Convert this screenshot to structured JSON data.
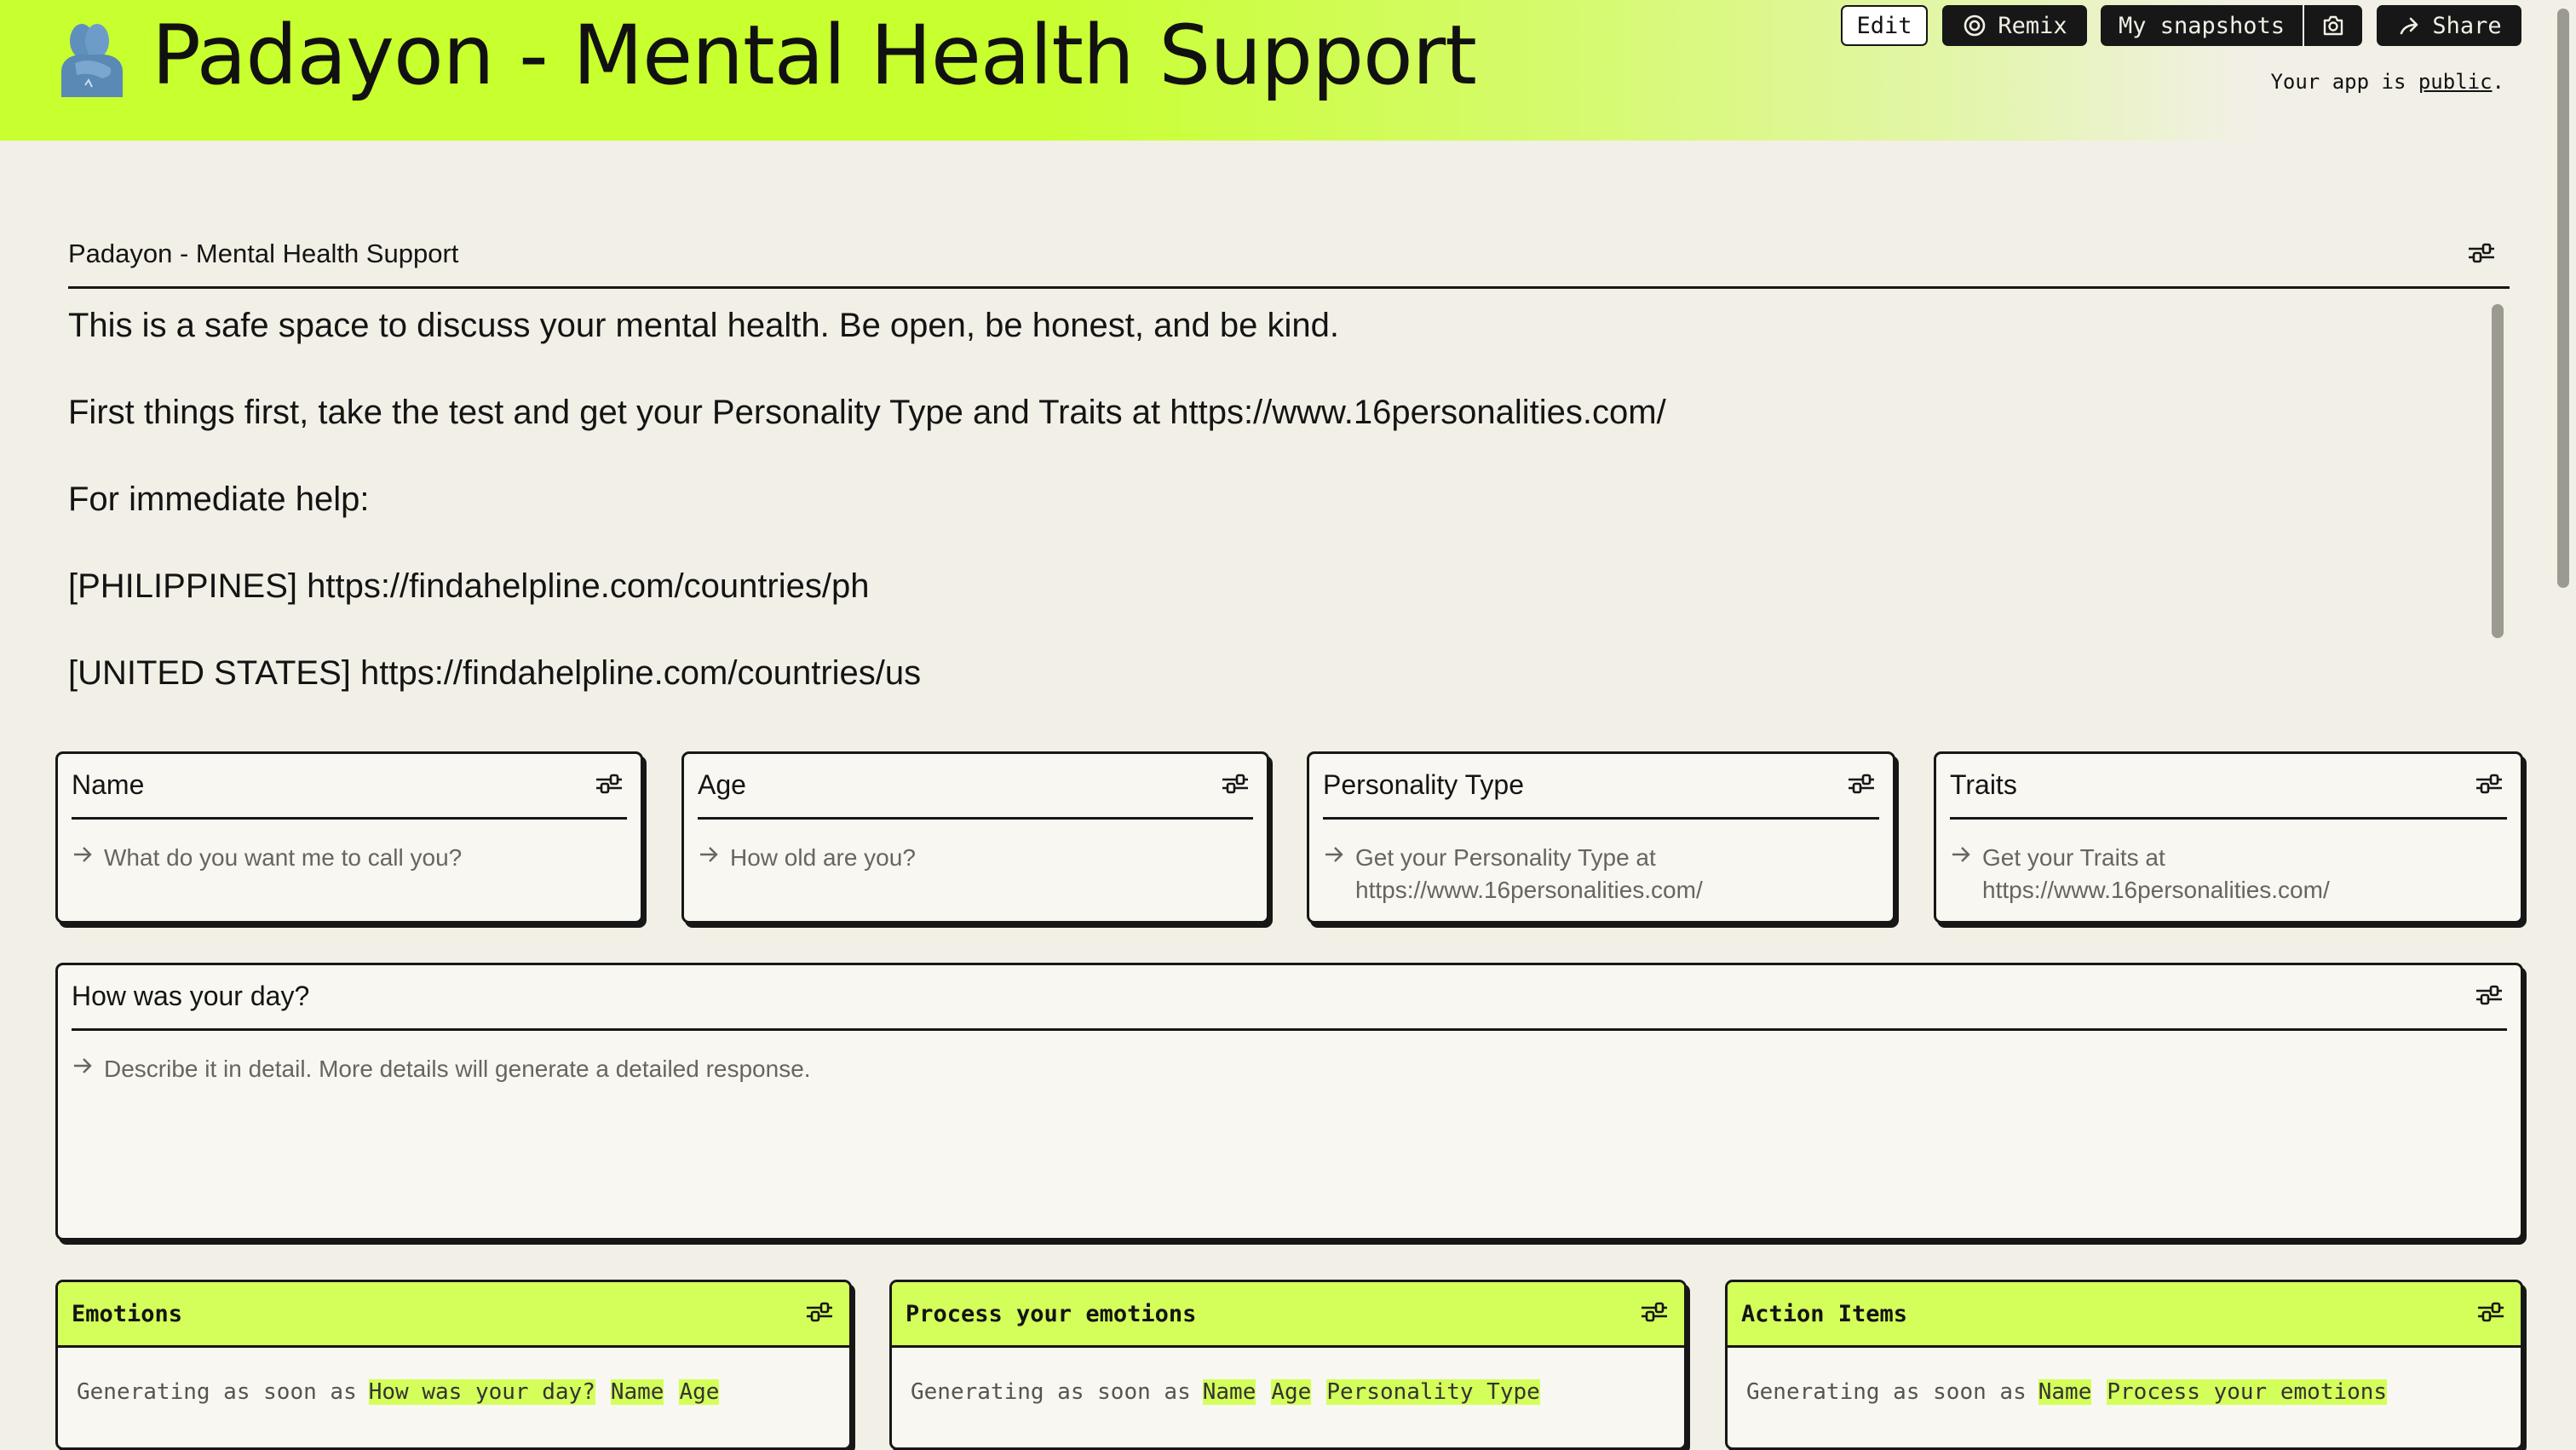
{
  "header": {
    "app_title": "Padayon - Mental Health Support",
    "emoji_icon": "people-hugging-icon",
    "buttons": {
      "edit": "Edit",
      "remix": "Remix",
      "snapshots": "My snapshots",
      "share": "Share"
    },
    "public_note_prefix": "Your app is ",
    "public_note_link": "public",
    "public_note_suffix": "."
  },
  "description": {
    "title": "Padayon - Mental Health Support",
    "lines": [
      "This is a safe space to discuss your mental health. Be open, be honest, and be kind.",
      "First things first, take the test and get your Personality Type and Traits at https://www.16personalities.com/",
      "For immediate help:",
      "[PHILIPPINES] https://findahelpline.com/countries/ph",
      "[UNITED STATES] https://findahelpline.com/countries/us"
    ]
  },
  "inputs": [
    {
      "label": "Name",
      "placeholder": "What do you want me to call you?"
    },
    {
      "label": "Age",
      "placeholder": "How old are you?"
    },
    {
      "label": "Personality Type",
      "placeholder": "Get your Personality Type at https://www.16personalities.com/"
    },
    {
      "label": "Traits",
      "placeholder": "Get your Traits at https://www.16personalities.com/"
    },
    {
      "label": "How was your day?",
      "placeholder": "Describe it in detail. More details will generate a detailed response."
    }
  ],
  "outputs": [
    {
      "title": "Emotions",
      "status_prefix": "Generating as soon as",
      "deps": [
        "How was your day?",
        "Name",
        "Age"
      ]
    },
    {
      "title": "Process your emotions",
      "status_prefix": "Generating as soon as",
      "deps": [
        "Name",
        "Age",
        "Personality Type"
      ]
    },
    {
      "title": "Action Items",
      "status_prefix": "Generating as soon as",
      "deps": [
        "Name",
        "Process your emotions"
      ]
    }
  ],
  "colors": {
    "accent_lime": "#d4ff5a",
    "header_lime": "#c8ff2e",
    "background": "#f2f0e6",
    "ink": "#171717"
  }
}
